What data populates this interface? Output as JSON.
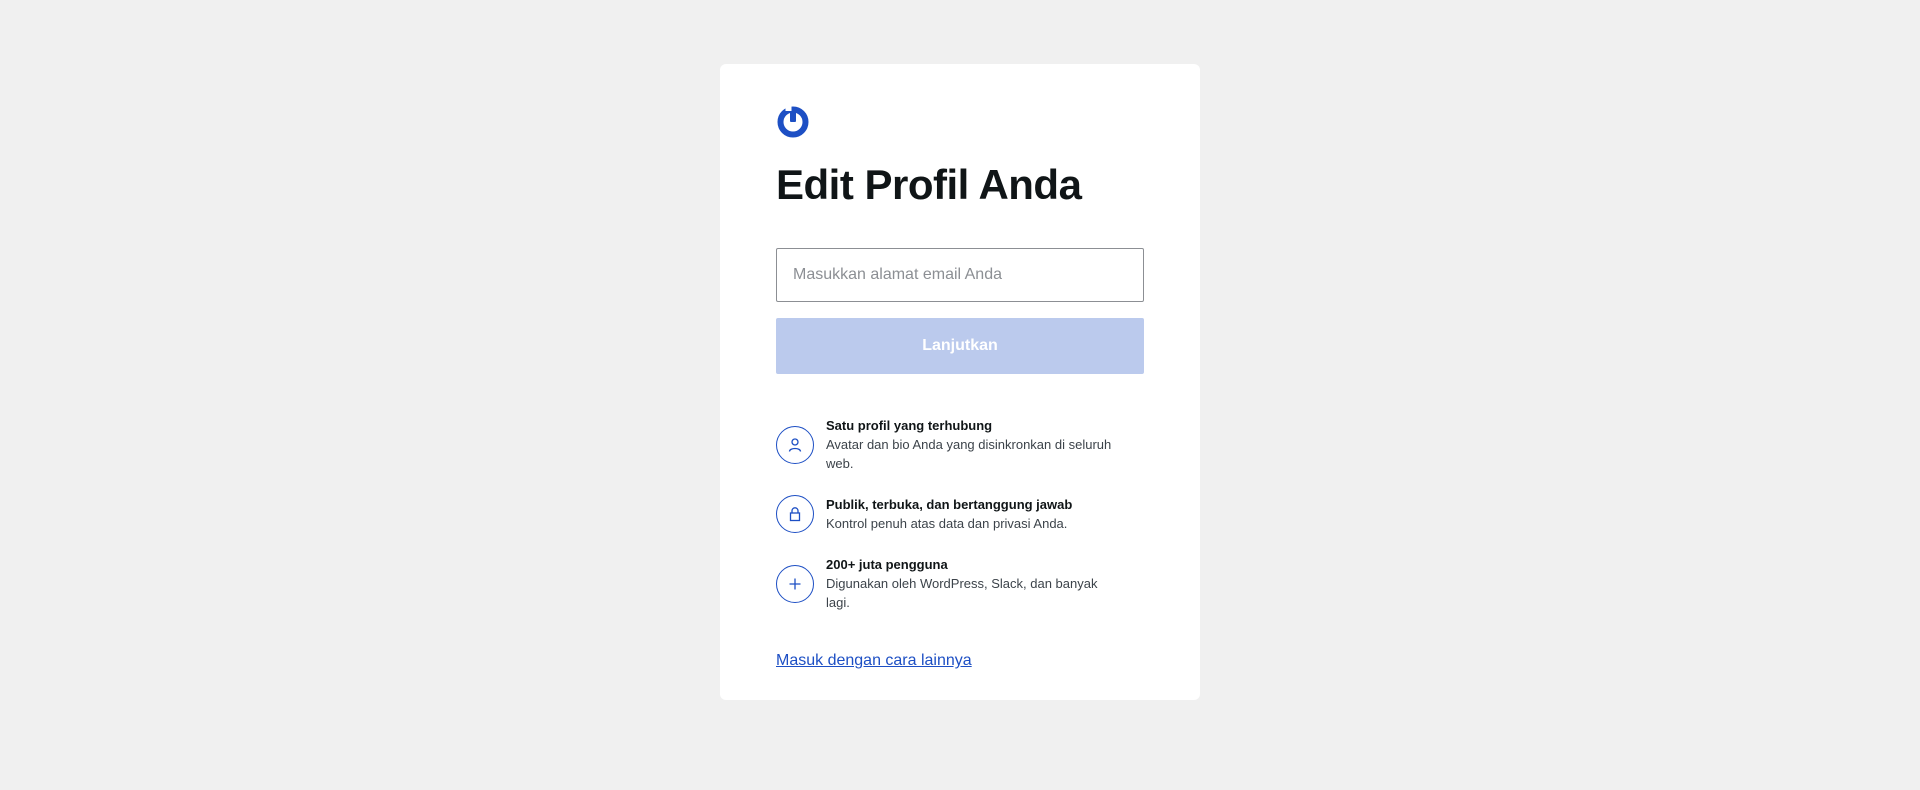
{
  "page": {
    "title": "Edit Profil Anda"
  },
  "form": {
    "email_placeholder": "Masukkan alamat email Anda",
    "email_value": "",
    "continue_label": "Lanjutkan"
  },
  "features": [
    {
      "icon": "user-icon",
      "title": "Satu profil yang terhubung",
      "description": "Avatar dan bio Anda yang disinkronkan di seluruh web."
    },
    {
      "icon": "lock-icon",
      "title": "Publik, terbuka, dan bertanggung jawab",
      "description": "Kontrol penuh atas data dan privasi Anda."
    },
    {
      "icon": "plus-icon",
      "title": "200+ juta pengguna",
      "description": "Digunakan oleh WordPress, Slack, dan banyak lagi."
    }
  ],
  "links": {
    "alt_signin": "Masuk dengan cara lainnya"
  },
  "colors": {
    "accent": "#1d4fc4",
    "button_disabled": "#bbcaed",
    "background": "#f0f0f0",
    "card": "#ffffff"
  }
}
